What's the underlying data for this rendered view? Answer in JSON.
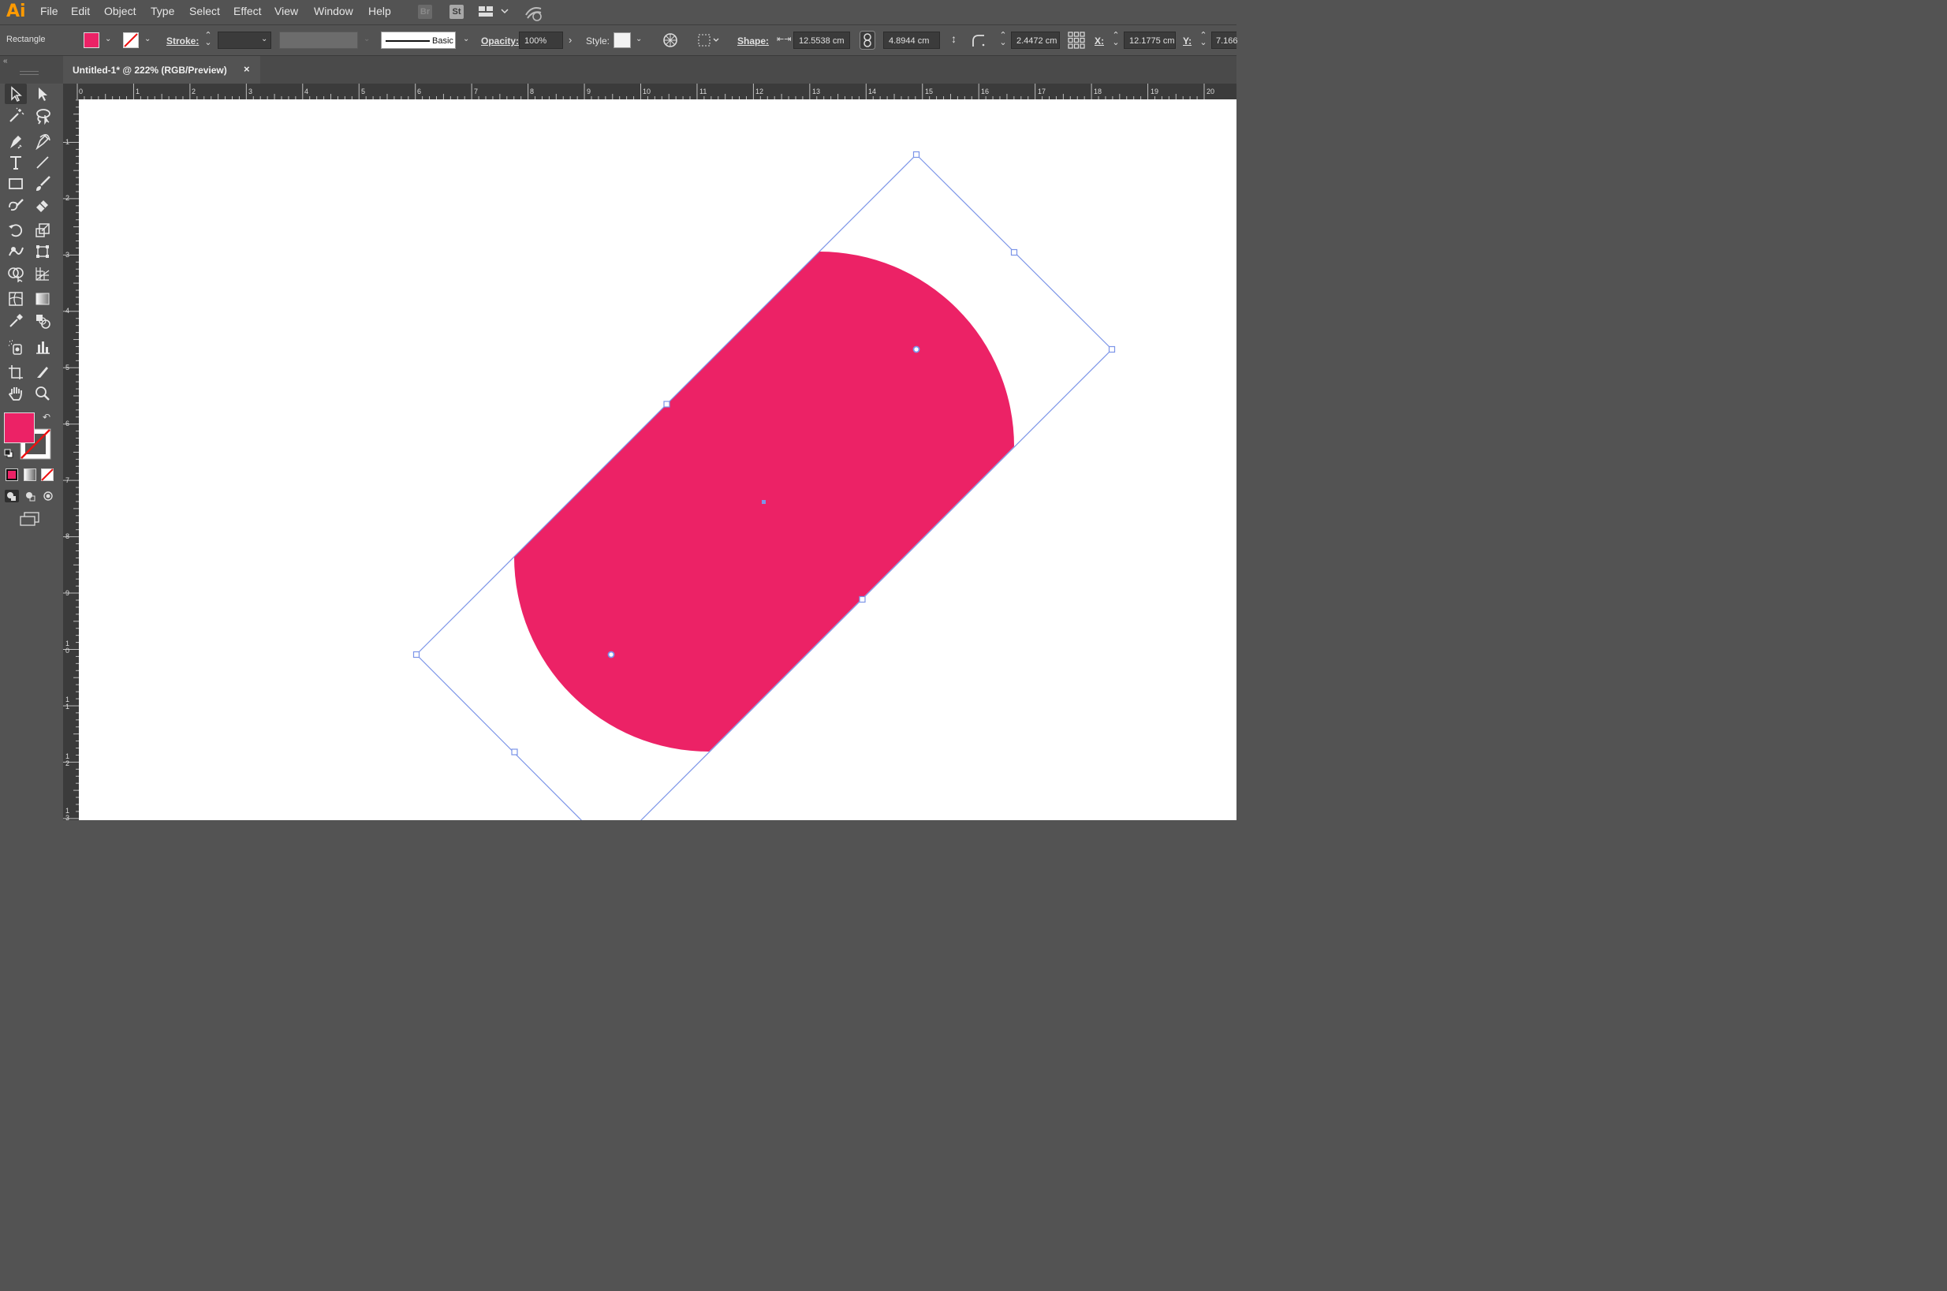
{
  "app": {
    "logo": "Ai"
  },
  "menu": [
    "File",
    "Edit",
    "Object",
    "Type",
    "Select",
    "Effect",
    "View",
    "Window",
    "Help"
  ],
  "menubar_icons": {
    "bridge": "Br",
    "stock": "St"
  },
  "control": {
    "object_type": "Rectangle",
    "fill_color": "#ec2266",
    "stroke_label": "Stroke:",
    "brush_label": "Basic",
    "opacity_label": "Opacity:",
    "opacity_value": "100%",
    "style_label": "Style:",
    "shape_label": "Shape:",
    "width_value": "12.5538 cm",
    "height_value": "4.8944 cm",
    "corner_value": "2.4472 cm",
    "x_label": "X:",
    "x_value": "12.1775 cm",
    "y_label": "Y:",
    "y_value": "7.166"
  },
  "document_tab": {
    "title": "Untitled-1* @ 222% (RGB/Preview)",
    "close": "×"
  },
  "ruler": {
    "h_labels": [
      "0",
      "1",
      "2",
      "3",
      "4",
      "5",
      "6",
      "7",
      "8",
      "9",
      "10",
      "11",
      "12",
      "13",
      "14",
      "15",
      "16",
      "17",
      "18",
      "19",
      "20"
    ],
    "v_labels": [
      "1",
      "2",
      "3",
      "4",
      "5",
      "6",
      "7",
      "8",
      "9",
      "10",
      "11",
      "12",
      "13"
    ]
  },
  "selection": {
    "color": "#7c95e8"
  },
  "shape": {
    "fill": "#ec2266"
  }
}
